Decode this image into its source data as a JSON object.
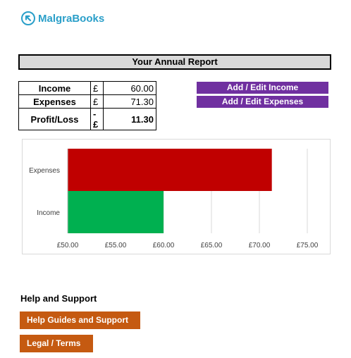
{
  "brand": {
    "name": "MalgraBooks",
    "icon": "arrow-up-left-icon",
    "color": "#2a9fc9"
  },
  "report": {
    "title": "Your Annual Report"
  },
  "summary": {
    "rows": [
      {
        "label": "Income",
        "currency": "£",
        "value": "60.00"
      },
      {
        "label": "Expenses",
        "currency": "£",
        "value": "71.30"
      },
      {
        "label": "Profit/Loss",
        "currency": "-£",
        "value": "11.30"
      }
    ]
  },
  "actions": {
    "income_label": "Add / Edit Income",
    "expenses_label": "Add / Edit Expenses",
    "color": "#7030a0"
  },
  "chart_data": {
    "type": "bar",
    "orientation": "horizontal",
    "categories": [
      "Expenses",
      "Income"
    ],
    "values": [
      71.3,
      60.0
    ],
    "colors": [
      "#c00000",
      "#00b050"
    ],
    "xlim": [
      50,
      75
    ],
    "xticks": [
      "£50.00",
      "£55.00",
      "£60.00",
      "£65.00",
      "£70.00",
      "£75.00"
    ],
    "grid": true
  },
  "help": {
    "title": "Help and Support",
    "guides_label": "Help Guides and Support",
    "legal_label": "Legal / Terms",
    "color": "#c55a11"
  }
}
